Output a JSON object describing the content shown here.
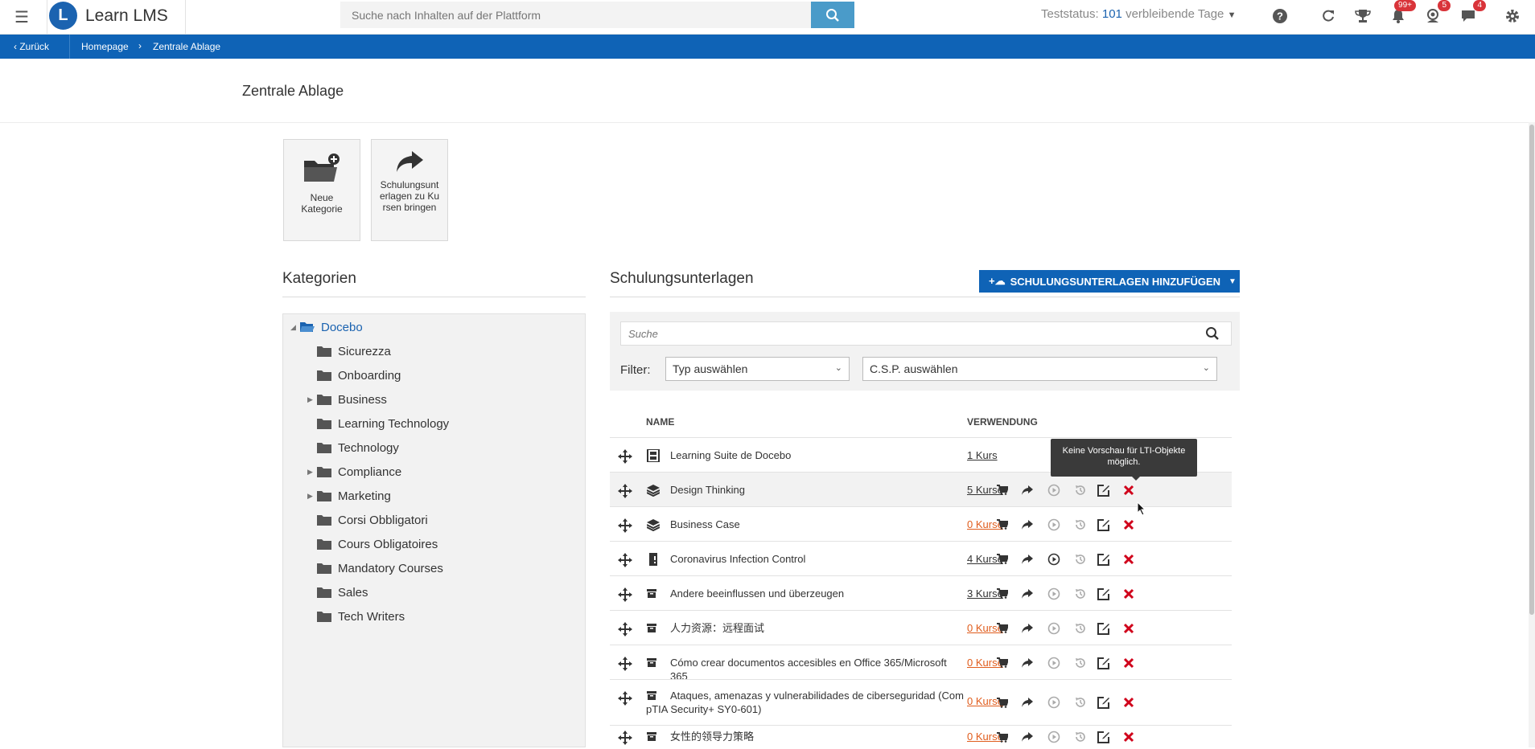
{
  "header": {
    "app_title": "Learn LMS",
    "logo_letter": "L",
    "search_placeholder": "Suche nach Inhalten auf der Plattform",
    "trial_prefix": "Teststatus:",
    "trial_days": "101",
    "trial_suffix": "verbleibende Tage",
    "icons": [
      "help-icon",
      "sync-icon",
      "trophy-icon",
      "notifications-icon",
      "users-icon",
      "messages-icon",
      "settings-icon"
    ],
    "badges": {
      "notifications": "99+",
      "users": "5",
      "messages": "4"
    }
  },
  "breadcrumb": {
    "back": "Zurück",
    "items": [
      "Homepage",
      "Zentrale Ablage"
    ]
  },
  "page_title": "Zentrale Ablage",
  "tiles": [
    {
      "label": "Neue Kategorie",
      "icon": "folder-add-icon"
    },
    {
      "label": "Schulungsunterlagen zu Kursen bringen",
      "icon": "share-arrow-icon"
    }
  ],
  "categories": {
    "title": "Kategorien",
    "root": "Docebo",
    "items": [
      {
        "label": "Sicurezza",
        "expandable": false
      },
      {
        "label": "Onboarding",
        "expandable": false
      },
      {
        "label": "Business",
        "expandable": true
      },
      {
        "label": "Learning Technology",
        "expandable": false
      },
      {
        "label": "Technology",
        "expandable": false
      },
      {
        "label": "Compliance",
        "expandable": true
      },
      {
        "label": "Marketing",
        "expandable": true
      },
      {
        "label": "Corsi Obbligatori",
        "expandable": false
      },
      {
        "label": "Cours Obligatoires",
        "expandable": false
      },
      {
        "label": "Mandatory Courses",
        "expandable": false
      },
      {
        "label": "Sales",
        "expandable": false
      },
      {
        "label": "Tech Writers",
        "expandable": false
      }
    ]
  },
  "materials": {
    "title": "Schulungsunterlagen",
    "add_button": "SCHULUNGSUNTERLAGEN HINZUFÜGEN",
    "search_placeholder": "Suche",
    "filter_label": "Filter:",
    "type_select": "Typ auswählen",
    "csp_select": "C.S.P. auswählen",
    "col_name": "NAME",
    "col_usage": "VERWENDUNG",
    "tooltip": "Keine Vorschau für LTI-Objekte möglich.",
    "rows": [
      {
        "name": "Learning Suite de Docebo",
        "usage": "1 Kurs",
        "type_icon": "video-icon"
      },
      {
        "name": "Design Thinking",
        "usage": "5 Kurse",
        "type_icon": "layers-icon"
      },
      {
        "name": "Business Case",
        "usage": "0 Kurse",
        "type_icon": "layers-icon"
      },
      {
        "name": "Coronavirus Infection Control",
        "usage": "4 Kurse",
        "type_icon": "document-icon"
      },
      {
        "name": "Andere beeinflussen und überzeugen",
        "usage": "3 Kurse",
        "type_icon": "archive-icon"
      },
      {
        "name": "人力资源：远程面试",
        "usage": "0 Kurse",
        "type_icon": "archive-icon"
      },
      {
        "name": "Cómo crear documentos accesibles en Office 365/Microsoft 365",
        "usage": "0 Kurse",
        "type_icon": "archive-icon"
      },
      {
        "name": "Ataques, amenazas y vulnerabilidades de ciberseguridad (CompTIA Security+ SY0-601)",
        "usage": "0 Kurse",
        "type_icon": "archive-icon"
      },
      {
        "name": "女性的领导力策略",
        "usage": "0 Kurse",
        "type_icon": "archive-icon"
      }
    ]
  },
  "colors": {
    "brand_blue": "#0f63b6",
    "danger": "#d0021b",
    "zero_usage": "#e05c1c"
  }
}
